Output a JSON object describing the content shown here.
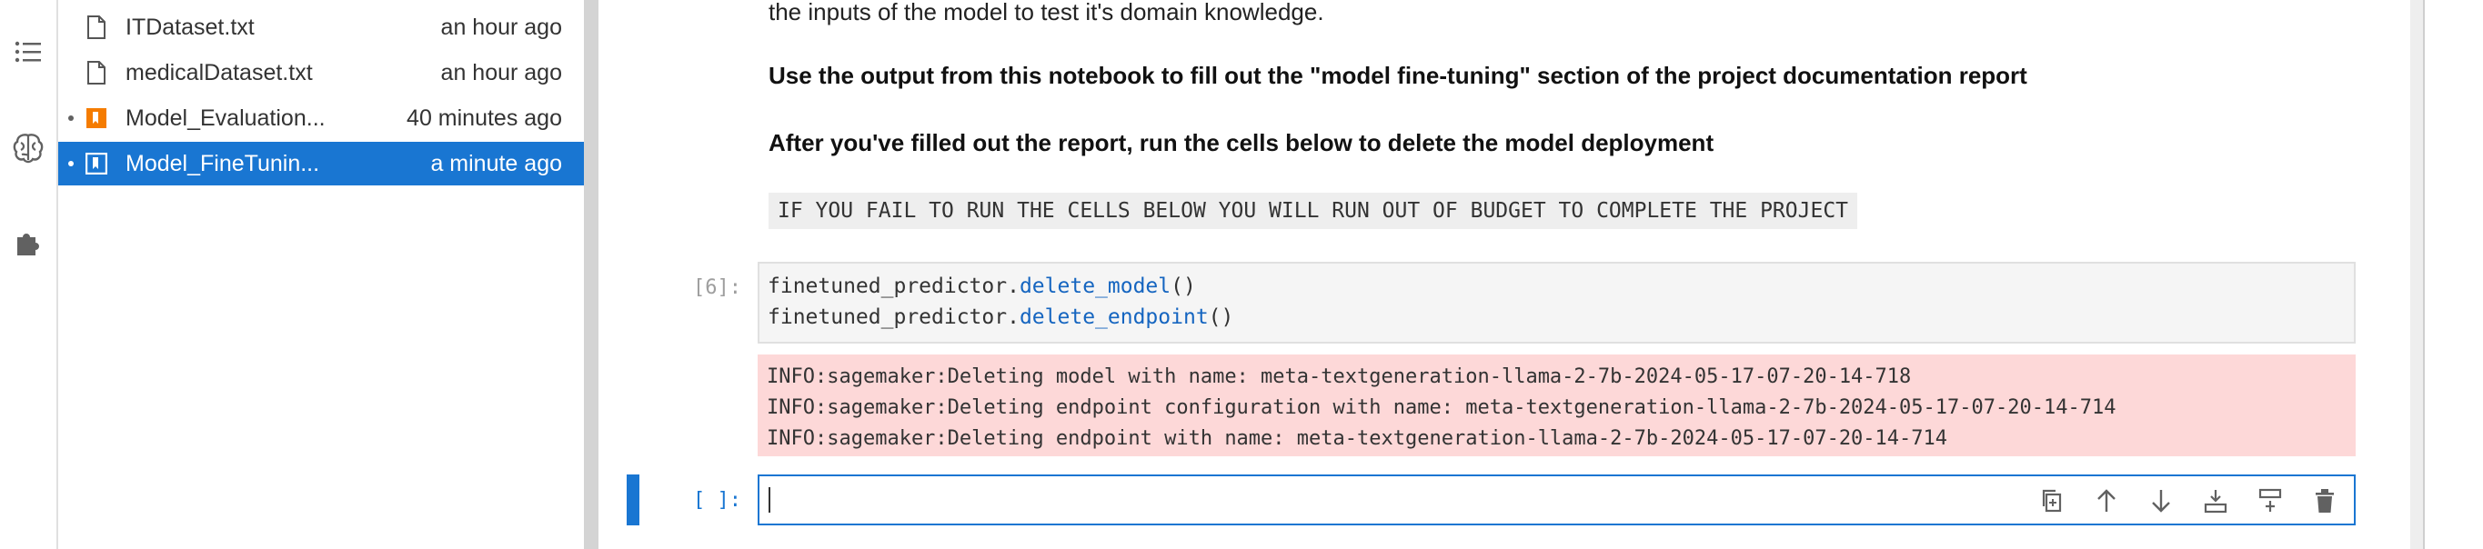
{
  "file_browser": {
    "files": [
      {
        "name": "ITDataset.txt",
        "modified": "an hour ago",
        "icon": "file-icon"
      },
      {
        "name": "medicalDataset.txt",
        "modified": "an hour ago",
        "icon": "file-icon"
      },
      {
        "name": "Model_Evaluation...",
        "modified": "40 minutes ago",
        "icon": "notebook-icon"
      },
      {
        "name": "Model_FineTunin...",
        "modified": "a minute ago",
        "icon": "notebook-icon"
      }
    ]
  },
  "notebook": {
    "intro_text": "the inputs of the model to test it's domain knowledge.",
    "instruction_1": "Use the output from this notebook to fill out the \"model fine-tuning\" section of the project documentation report",
    "instruction_2": "After you've filled out the report, run the cells below to delete the model deployment",
    "warning_code": "IF YOU FAIL TO RUN THE CELLS BELOW YOU WILL RUN OUT OF BUDGET TO COMPLETE THE PROJECT",
    "cell_6": {
      "prompt": "[6]:",
      "line1_obj": "finetuned_predictor.",
      "line1_fn": "delete_model",
      "line1_args": "()",
      "line2_obj": "finetuned_predictor.",
      "line2_fn": "delete_endpoint",
      "line2_args": "()"
    },
    "output_lines": [
      "INFO:sagemaker:Deleting model with name: meta-textgeneration-llama-2-7b-2024-05-17-07-20-14-718",
      "INFO:sagemaker:Deleting endpoint configuration with name: meta-textgeneration-llama-2-7b-2024-05-17-07-20-14-714",
      "INFO:sagemaker:Deleting endpoint with name: meta-textgeneration-llama-2-7b-2024-05-17-07-20-14-714"
    ],
    "active_cell": {
      "prompt": "[ ]:"
    }
  },
  "icons": {
    "activity": [
      "table-of-contents-icon",
      "brain-icon",
      "puzzle-icon"
    ],
    "cell_toolbar": [
      "duplicate-icon",
      "move-up-icon",
      "move-down-icon",
      "insert-below-icon",
      "insert-above-icon",
      "delete-icon"
    ]
  },
  "colors": {
    "accent": "#1976d2",
    "selected_row": "#1976d2",
    "stderr_bg": "#fdd8d8",
    "function_name": "#1565c0",
    "notebook_icon": "#f57c00"
  }
}
